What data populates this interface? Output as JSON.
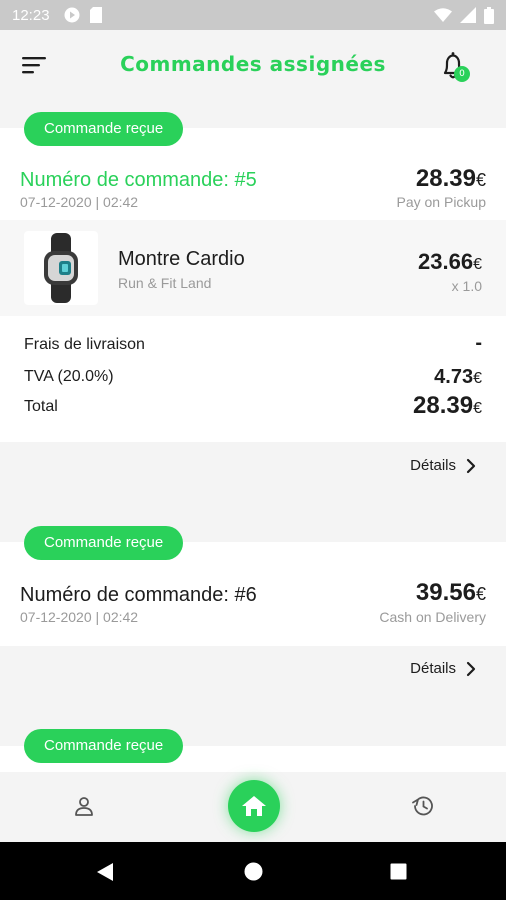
{
  "status_bar": {
    "time": "12:23",
    "icons": [
      "google-play-icon",
      "sd-card-icon",
      "wifi-icon",
      "signal-icon",
      "battery-icon"
    ]
  },
  "app_bar": {
    "title": "Commandes assignées",
    "notification_count": "0"
  },
  "orders": [
    {
      "status": "Commande reçue",
      "order_number": "Numéro de commande: #5",
      "date": "07-12-2020 | 02:42",
      "total": "28.39",
      "currency": "€",
      "payment": "Pay on Pickup",
      "items": [
        {
          "name": "Montre Cardio",
          "store": "Run & Fit Land",
          "price": "23.66",
          "currency": "€",
          "qty": "x 1.0"
        }
      ],
      "summary": {
        "delivery_label": "Frais de livraison",
        "delivery_value": "-",
        "tax_label": "TVA (20.0%)",
        "tax_value": "4.73",
        "total_label": "Total",
        "total_value": "28.39",
        "currency": "€"
      },
      "details_label": "Détails"
    },
    {
      "status": "Commande reçue",
      "order_number": "Numéro de commande: #6",
      "date": "07-12-2020 | 02:42",
      "total": "39.56",
      "currency": "€",
      "payment": "Cash on Delivery",
      "details_label": "Détails"
    },
    {
      "status": "Commande reçue"
    }
  ],
  "bottom_nav": {
    "items": [
      "profile-icon",
      "home-icon",
      "history-icon"
    ]
  },
  "colors": {
    "accent": "#2ad15a",
    "background": "#f4f4f4",
    "card": "#ffffff",
    "muted_text": "#9a9a9a"
  }
}
